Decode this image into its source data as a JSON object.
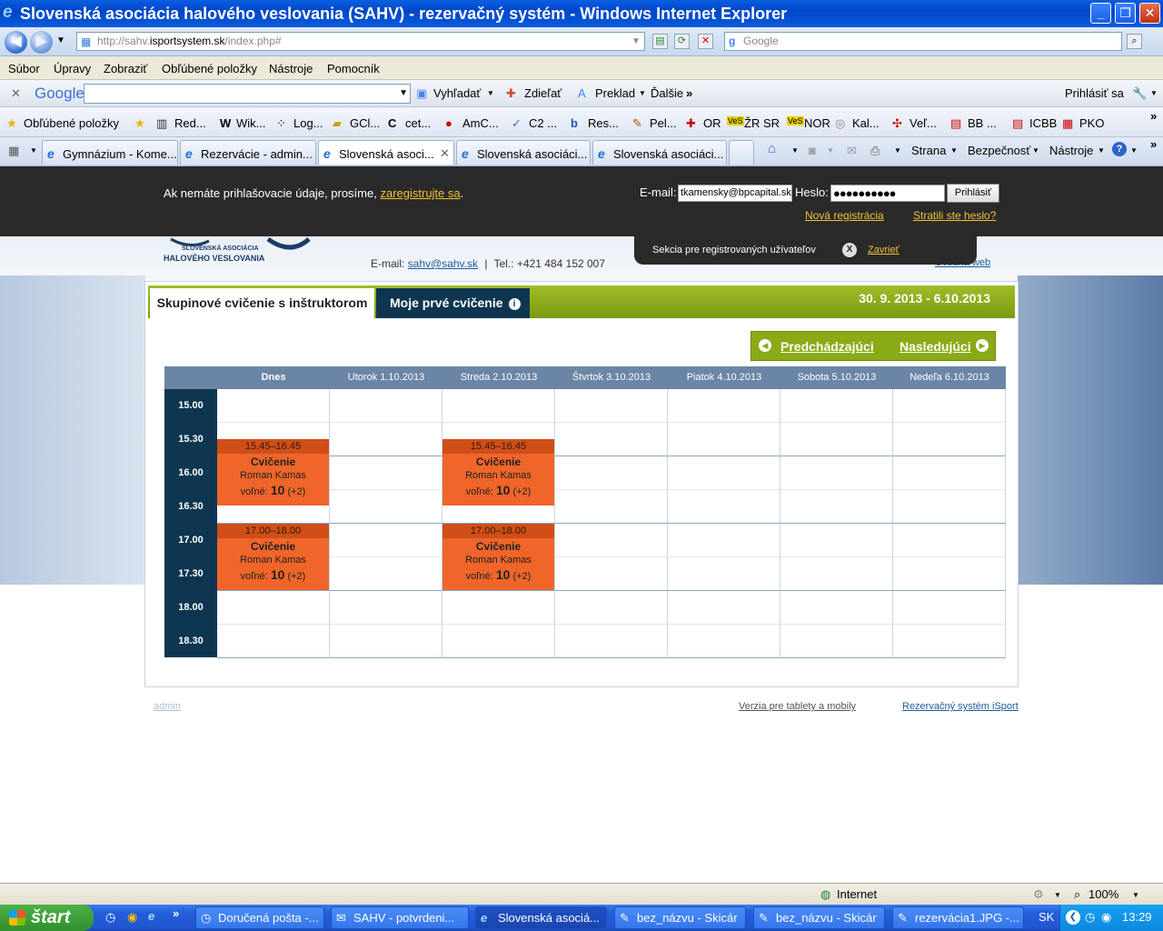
{
  "window": {
    "title": "Slovenská asociácia halového veslovania (SAHV) - rezervačný systém - Windows Internet Explorer"
  },
  "address": {
    "url_prefix": "http://sahv.",
    "url_domain": "isportsystem.sk",
    "url_suffix": "/index.php#",
    "search_placeholder": "Google"
  },
  "menu": [
    "Súbor",
    "Úpravy",
    "Zobraziť",
    "Obľúbené položky",
    "Nástroje",
    "Pomocník"
  ],
  "google_toolbar": {
    "logo": "Google",
    "search": "Vyhľadať",
    "share": "Zdieľať",
    "translate": "Preklad",
    "more": "Ďalšie",
    "signin": "Prihlásiť sa"
  },
  "favorites": {
    "label": "Obľúbené položky",
    "items": [
      "Red...",
      "Wik...",
      "Log...",
      "GCl...",
      "cet...",
      "AmC...",
      "C2 ...",
      "Res...",
      "Pel...",
      "OR",
      "ŽR SR",
      "NOR",
      "Kal...",
      "Veľ...",
      "BB ...",
      "ICBB",
      "PKO"
    ]
  },
  "tabs": {
    "items": [
      "Gymnázium - Kome...",
      "Rezervácie - admin...",
      "Slovenská asoci...",
      "Slovenská asociáci...",
      "Slovenská asociáci..."
    ],
    "tools": [
      "Strana",
      "Bezpečnosť",
      "Nástroje"
    ]
  },
  "login": {
    "notice": "Ak nemáte prihlašovacie údaje, prosíme, ",
    "notice_link": "zaregistrujte sa",
    "notice_end": ".",
    "email_label": "E-mail:",
    "email_value": "tkamensky@bpcapital.sk",
    "password_label": "Heslo:",
    "password_value": "●●●●●●●●●●",
    "submit": "Prihlásiť",
    "new_registration": "Nová registrácia",
    "lost_password": "Stratili ste heslo?",
    "section_label": "Sekcia pre registrovaných užívateľov",
    "close_label": "Zavrieť"
  },
  "site": {
    "logo_line1": "SLOVENSKÁ ASOCIÁCIA",
    "logo_line2": "HALOVÉHO VESLOVANIA",
    "email_label": "E-mail: ",
    "email": "sahv@sahv.sk",
    "separator": "|",
    "phone": "Tel.: +421 484 152 007",
    "web_link": "Úvodná web"
  },
  "schedule": {
    "tab_active": "Skupinové cvičenie s inštruktorom",
    "tab_other": "Moje prvé cvičenie",
    "date_range": "30. 9. 2013 - 6.10.2013",
    "prev": "Predchádzajúci",
    "next": "Nasledujúci",
    "days": [
      {
        "label": "Dnes",
        "today": true
      },
      {
        "label": "Utorok  1.10.2013"
      },
      {
        "label": "Streda  2.10.2013"
      },
      {
        "label": "Štvrtok  3.10.2013"
      },
      {
        "label": "Piatok  4.10.2013"
      },
      {
        "label": "Sobota  5.10.2013"
      },
      {
        "label": "Nedeľa  6.10.2013"
      }
    ],
    "times": [
      "15.00",
      "15.30",
      "16.00",
      "16.30",
      "17.00",
      "17.30",
      "18.00",
      "18.30"
    ],
    "free_label": "voľné:",
    "events": [
      {
        "day": 0,
        "slot": 1,
        "time": "15.45–16.45",
        "title": "Cvičenie",
        "trainer": "Roman Kamas",
        "free": "10",
        "extra": "(+2)"
      },
      {
        "day": 2,
        "slot": 1,
        "time": "15.45–16.45",
        "title": "Cvičenie",
        "trainer": "Roman Kamas",
        "free": "10",
        "extra": "(+2)"
      },
      {
        "day": 0,
        "slot": 4,
        "time": "17.00–18.00",
        "title": "Cvičenie",
        "trainer": "Roman Kamas",
        "free": "10",
        "extra": "(+2)"
      },
      {
        "day": 2,
        "slot": 4,
        "time": "17.00–18.00",
        "title": "Cvičenie",
        "trainer": "Roman Kamas",
        "free": "10",
        "extra": "(+2)"
      }
    ]
  },
  "footer": {
    "admin": "admin",
    "mobile": "Verzia pre tablety a mobily",
    "system": "Rezervačný systém iSport"
  },
  "status": {
    "zone": "Internet",
    "zoom": "100%"
  },
  "taskbar": {
    "start": "štart",
    "items": [
      "Doručená pošta -...",
      "SAHV - potvrdeni...",
      "Slovenská asociá...",
      "bez_názvu - Skicár",
      "bez_názvu - Skicár",
      "rezervácia1.JPG -..."
    ],
    "lang": "SK",
    "clock": "13:29"
  },
  "colors": {
    "accent_green": "#8aaa16",
    "navy": "#0e3650",
    "event_orange": "#f0652a",
    "link_yellow": "#f1c232"
  }
}
